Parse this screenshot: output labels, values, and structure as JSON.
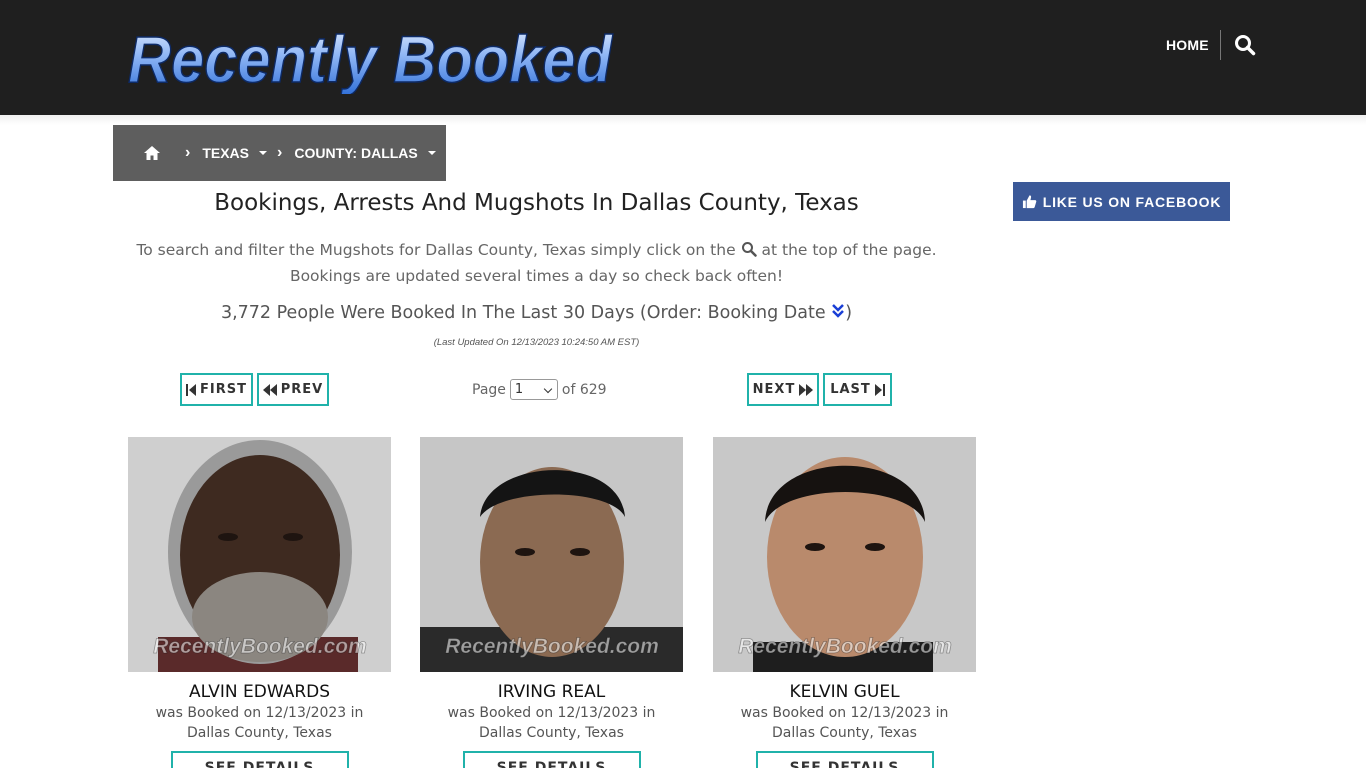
{
  "header": {
    "logo_text": "Recently Booked",
    "nav_home": "HOME"
  },
  "breadcrumb": {
    "state": "TEXAS",
    "county": "COUNTY: DALLAS"
  },
  "facebook": {
    "label": "LIKE US ON FACEBOOK"
  },
  "main": {
    "title": "Bookings, Arrests And Mugshots In Dallas County, Texas",
    "intro_before": "To search and filter the Mugshots for Dallas County, Texas simply click on the",
    "intro_after": "at the top of the page. Bookings are updated several times a day so check back often!",
    "count_text": "3,772 People Were Booked In The Last 30 Days (Order: Booking Date",
    "count_close": ")",
    "updated": "(Last Updated On 12/13/2023 10:24:50 AM EST)"
  },
  "pagination": {
    "first": "FIRST",
    "prev": "PREV",
    "next": "NEXT",
    "last": "LAST",
    "page_label": "Page",
    "page_value": "1",
    "of_label": "of 629"
  },
  "bookings": [
    {
      "name": "ALVIN EDWARDS",
      "line1": "was Booked on 12/13/2023 in",
      "line2": "Dallas County, Texas",
      "button": "SEE DETAILS",
      "watermark": "RecentlyBooked.com"
    },
    {
      "name": "IRVING REAL",
      "line1": "was Booked on 12/13/2023 in",
      "line2": "Dallas County, Texas",
      "button": "SEE DETAILS",
      "watermark": "RecentlyBooked.com"
    },
    {
      "name": "KELVIN GUEL",
      "line1": "was Booked on 12/13/2023 in",
      "line2": "Dallas County, Texas",
      "button": "SEE DETAILS",
      "watermark": "RecentlyBooked.com"
    }
  ],
  "colors": {
    "header_bg": "#1f1f1f",
    "breadcrumb_bg": "#5e5e5e",
    "accent_teal": "#20b2aa",
    "facebook_blue": "#3b5998",
    "logo_blue": "#4a86e8"
  },
  "icons": {
    "search": "search-icon",
    "home": "home-icon",
    "thumbs_up": "thumbs-up-icon",
    "sort": "double-chevron-down-icon"
  }
}
